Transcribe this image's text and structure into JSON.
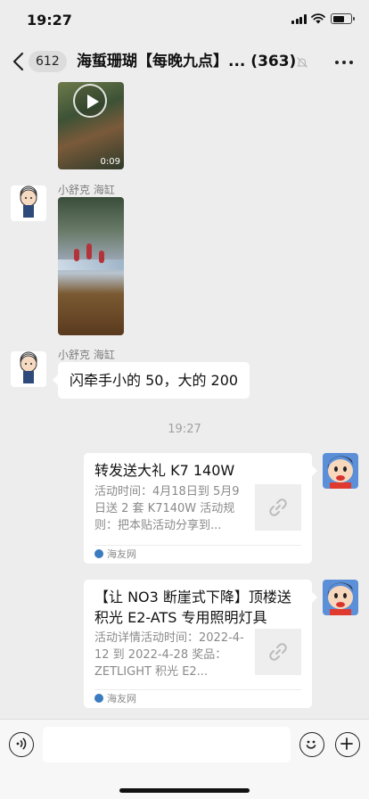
{
  "status_bar": {
    "time": "19:27"
  },
  "nav": {
    "back_count": "612",
    "title": "海蜇珊瑚【每晚九点】...",
    "member_count": "(363)"
  },
  "messages": {
    "video": {
      "duration": "0:09"
    },
    "msg1": {
      "sender": "小舒克 海缸"
    },
    "msg2": {
      "sender": "小舒克 海缸",
      "text": "闪牵手小的 50，大的 200"
    },
    "timestamp": "19:27",
    "card1": {
      "title": "转发送大礼 K7 140W",
      "desc": "活动时间：4月18日到 5月9日送 2 套 K7140W 活动规则：把本贴活动分享到...",
      "source": "海友网"
    },
    "card2": {
      "title": "【让 NO3 断崖式下降】顶楼送积光 E2-ATS 专用照明灯具",
      "desc": "活动详情活动时间：2022-4-12 到 2022-4-28 奖品：ZETLIGHT 积光 E2...",
      "source": "海友网"
    }
  },
  "icons": {
    "back": "chevron-left-icon",
    "mute": "bell-off-icon",
    "more": "more-icon",
    "voice": "voice-icon",
    "emoji": "emoji-icon",
    "plus": "plus-icon",
    "link": "link-icon"
  },
  "colors": {
    "background": "#ededed",
    "bubble": "#ffffff",
    "source_dot": "#3b7bbf"
  }
}
